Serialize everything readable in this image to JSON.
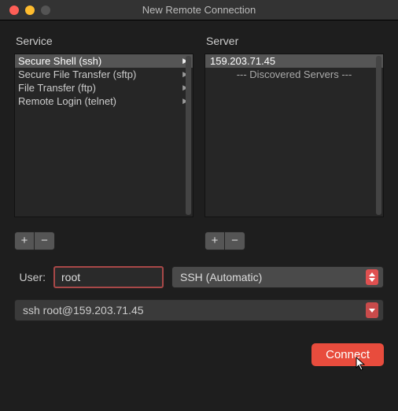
{
  "window": {
    "title": "New Remote Connection"
  },
  "labels": {
    "service": "Service",
    "server": "Server",
    "user": "User:"
  },
  "services": [
    {
      "label": "Secure Shell (ssh)",
      "selected": true
    },
    {
      "label": "Secure File Transfer (sftp)",
      "selected": false
    },
    {
      "label": "File Transfer (ftp)",
      "selected": false
    },
    {
      "label": "Remote Login (telnet)",
      "selected": false
    }
  ],
  "servers": [
    {
      "label": "159.203.71.45",
      "selected": true
    }
  ],
  "discovered_label": "--- Discovered Servers ---",
  "buttons": {
    "add": "+",
    "remove": "−",
    "connect": "Connect"
  },
  "user": {
    "value": "root"
  },
  "protocol": {
    "selected": "SSH (Automatic)"
  },
  "command": {
    "value": "ssh root@159.203.71.45"
  },
  "colors": {
    "accent": "#e84c3d",
    "error_border": "#a84848",
    "bg": "#1e1e1e"
  }
}
